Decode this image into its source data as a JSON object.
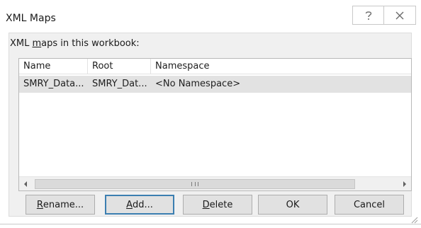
{
  "window": {
    "title": "XML Maps",
    "help_icon": "help-icon",
    "close_icon": "close-icon"
  },
  "group": {
    "label_pre": "XML ",
    "label_mnemonic": "m",
    "label_post": "aps in this workbook:"
  },
  "list": {
    "columns": [
      "Name",
      "Root",
      "Namespace"
    ],
    "rows": [
      {
        "name": "SMRY_Data...",
        "root": "SMRY_Dat...",
        "namespace": "<No Namespace>"
      }
    ],
    "scroll_left_icon": "scroll-left-arrow-icon",
    "scroll_right_icon": "scroll-right-arrow-icon",
    "grip_icon": "scroll-thumb-grip-icon"
  },
  "buttons": {
    "rename": {
      "mnemonic": "R",
      "rest": "ename..."
    },
    "add": {
      "mnemonic": "A",
      "rest": "dd..."
    },
    "delete": {
      "mnemonic": "D",
      "rest": "elete"
    },
    "ok": "OK",
    "cancel": "Cancel"
  }
}
